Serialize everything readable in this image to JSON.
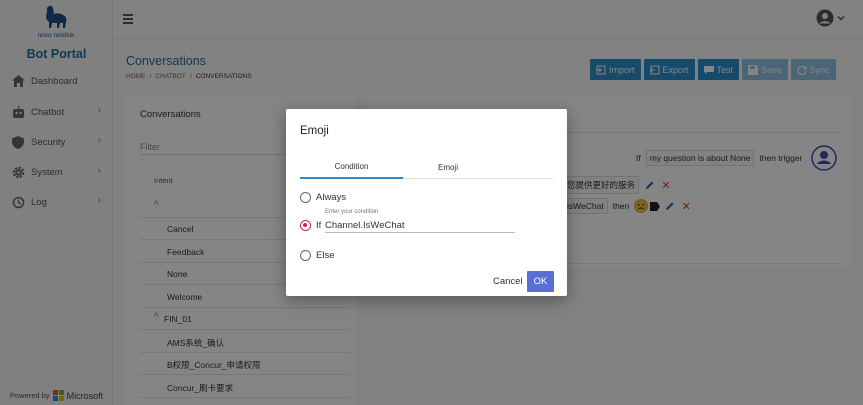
{
  "sidebar": {
    "brand": "Bot Portal",
    "logo_text": "novo nordisk",
    "items": [
      {
        "label": "Dashboard",
        "icon": "home-icon",
        "has_children": false
      },
      {
        "label": "Chatbot",
        "icon": "robot-icon",
        "has_children": true
      },
      {
        "label": "Security",
        "icon": "shield-icon",
        "has_children": true
      },
      {
        "label": "System",
        "icon": "gear-icon",
        "has_children": true
      },
      {
        "label": "Log",
        "icon": "history-icon",
        "has_children": true
      }
    ],
    "powered_by": "Powered by",
    "powered_brand": "Microsoft"
  },
  "header": {
    "title": "Conversations",
    "breadcrumb": [
      "HOME",
      "CHATBOT",
      "CONVERSATIONS"
    ],
    "actions": [
      {
        "label": "Import",
        "icon": "import-icon",
        "enabled": true
      },
      {
        "label": "Export",
        "icon": "export-icon",
        "enabled": true
      },
      {
        "label": "Test",
        "icon": "chat-icon",
        "enabled": true
      },
      {
        "label": "Save",
        "icon": "save-icon",
        "enabled": false
      },
      {
        "label": "Sync",
        "icon": "sync-icon",
        "enabled": false
      }
    ]
  },
  "conversations_panel": {
    "title": "Conversations",
    "filter_placeholder": "Filter",
    "column": "Intent",
    "collapse_glyph": "^",
    "rows": [
      "Cancel",
      "Feedback",
      "None",
      "Welcome"
    ],
    "group": "FIN_01",
    "group_rows": [
      "AMS系统_确认",
      "B权限_Concur_申请权限",
      "Concur_刷卡要求"
    ]
  },
  "rule_panel": {
    "row1": {
      "prefix": "If",
      "chip": "my question is about None",
      "suffix": "then trigger"
    },
    "row2_text": "您提供更好的服务",
    "row3": {
      "chip": "lsWeChat",
      "then": "then"
    }
  },
  "dialog": {
    "title": "Emoji",
    "tabs": [
      "Condition",
      "Emoji"
    ],
    "options": {
      "always": "Always",
      "if": "If",
      "else": "Else"
    },
    "condition_label": "Enter your condition",
    "condition_value": "Channel.IsWeChat",
    "cancel": "Cancel",
    "ok": "OK"
  },
  "colors": {
    "primary": "#2d8ecc",
    "ok_button": "#5a6fd6",
    "radio_checked": "#d81b60",
    "brand_text": "#1f6e9c",
    "delete": "#e53935",
    "avatar": "#3f51b5"
  }
}
